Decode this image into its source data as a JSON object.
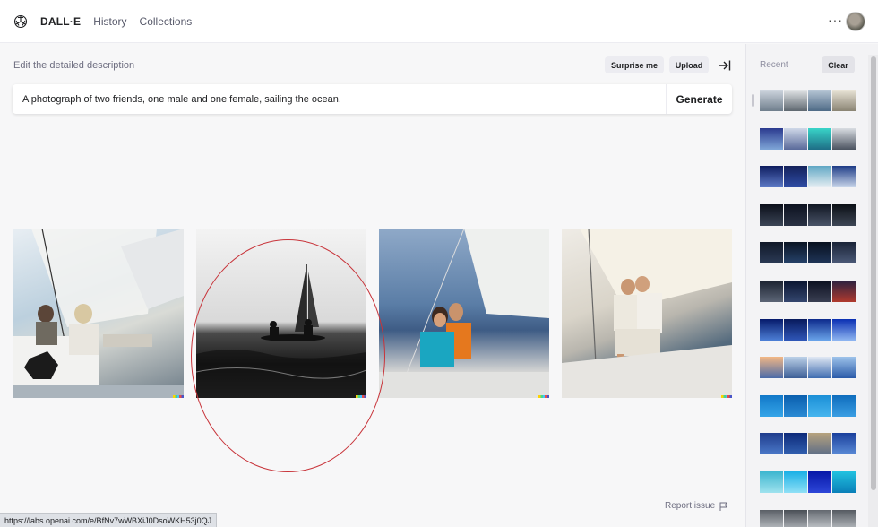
{
  "header": {
    "brand": "DALL·E",
    "nav": [
      "History",
      "Collections"
    ],
    "more": "···"
  },
  "editor": {
    "description_label": "Edit the detailed description",
    "surprise_label": "Surprise me",
    "upload_label": "Upload",
    "prompt_value": "A photograph of two friends, one male and one female, sailing the ocean.",
    "generate_label": "Generate"
  },
  "results": {
    "images": [
      "generated-image-1",
      "generated-image-2",
      "generated-image-3",
      "generated-image-4"
    ]
  },
  "footer": {
    "report_label": "Report issue",
    "status_url": "https://labs.openai.com/e/BfNv7wWBXiJ0DsoWKH53j0QJ"
  },
  "sidebar": {
    "recent_label": "Recent",
    "clear_label": "Clear"
  },
  "colors": {
    "annotation_circle": "#c8343a",
    "background": "#f7f7f8"
  },
  "icons": [
    "openai-logo-icon",
    "more-dots-icon",
    "collapse-panel-icon",
    "flag-icon"
  ]
}
